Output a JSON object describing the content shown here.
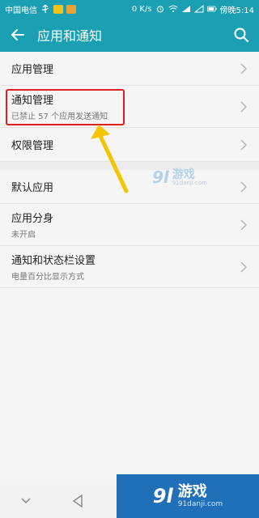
{
  "status_bar": {
    "carrier": "中国电信",
    "speed": "0 K/s",
    "time": "傍晚5:14"
  },
  "app_bar": {
    "title": "应用和通知",
    "back_icon": "arrow-left-icon",
    "search_icon": "search-icon"
  },
  "list": {
    "group1": [
      {
        "title": "应用管理",
        "sub": ""
      },
      {
        "title": "通知管理",
        "sub": "已禁止 57 个应用发送通知"
      },
      {
        "title": "权限管理",
        "sub": ""
      }
    ],
    "group2": [
      {
        "title": "默认应用",
        "sub": ""
      },
      {
        "title": "应用分身",
        "sub": "未开启"
      },
      {
        "title": "通知和状态栏设置",
        "sub": "电量百分比显示方式"
      }
    ]
  },
  "watermark": {
    "logo": "9l",
    "name": "游戏",
    "url": "91danji.com"
  },
  "corner_brand": {
    "logo": "9l",
    "name": "游戏",
    "url": "91danji.com"
  },
  "colors": {
    "primary": "#1b9fb2",
    "highlight": "#e02020",
    "arrow": "#f5c400"
  }
}
